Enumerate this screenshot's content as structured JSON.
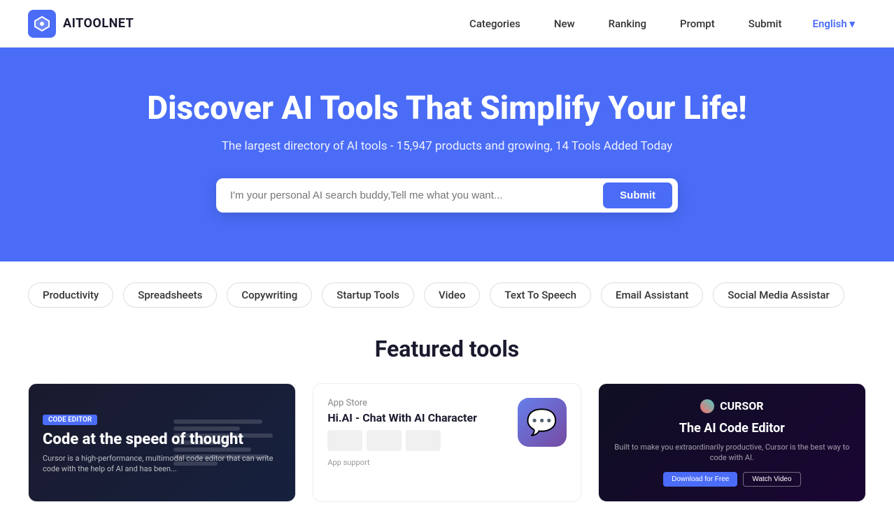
{
  "navbar": {
    "logo_text": "AITOOLNET",
    "links": [
      {
        "label": "Categories",
        "id": "categories"
      },
      {
        "label": "New",
        "id": "new"
      },
      {
        "label": "Ranking",
        "id": "ranking"
      },
      {
        "label": "Prompt",
        "id": "prompt"
      },
      {
        "label": "Submit",
        "id": "submit"
      }
    ],
    "language": "English ▾"
  },
  "hero": {
    "title": "Discover AI Tools That Simplify Your Life!",
    "subtitle": "The largest directory of AI tools - 15,947 products and growing, 14 Tools Added Today",
    "search_placeholder": "I'm your personal AI search buddy,Tell me what you want...",
    "search_button": "Submit"
  },
  "tags": [
    "Productivity",
    "Spreadsheets",
    "Copywriting",
    "Startup Tools",
    "Video",
    "Text To Speech",
    "Email Assistant",
    "Social Media Assistar"
  ],
  "featured": {
    "title": "Featured tools",
    "cards": [
      {
        "id": "cursor",
        "tag": "CODE EDITOR",
        "title": "Code at the speed of thought",
        "description": "Cursor is a high-performance, multimodal code editor that can write code with the help of AI and has been..."
      },
      {
        "id": "hiai",
        "brand": "App Store",
        "title": "Hi.AI - Chat With AI Character",
        "icon": "💬"
      },
      {
        "id": "cursor-ai",
        "brand_name": "CURSOR",
        "title": "The AI Code Editor",
        "subtitle": "Built to make you extraordinarily productive, Cursor is the best way to code with AI.",
        "btn1": "Download for Free",
        "btn2": "Watch Video"
      }
    ]
  }
}
